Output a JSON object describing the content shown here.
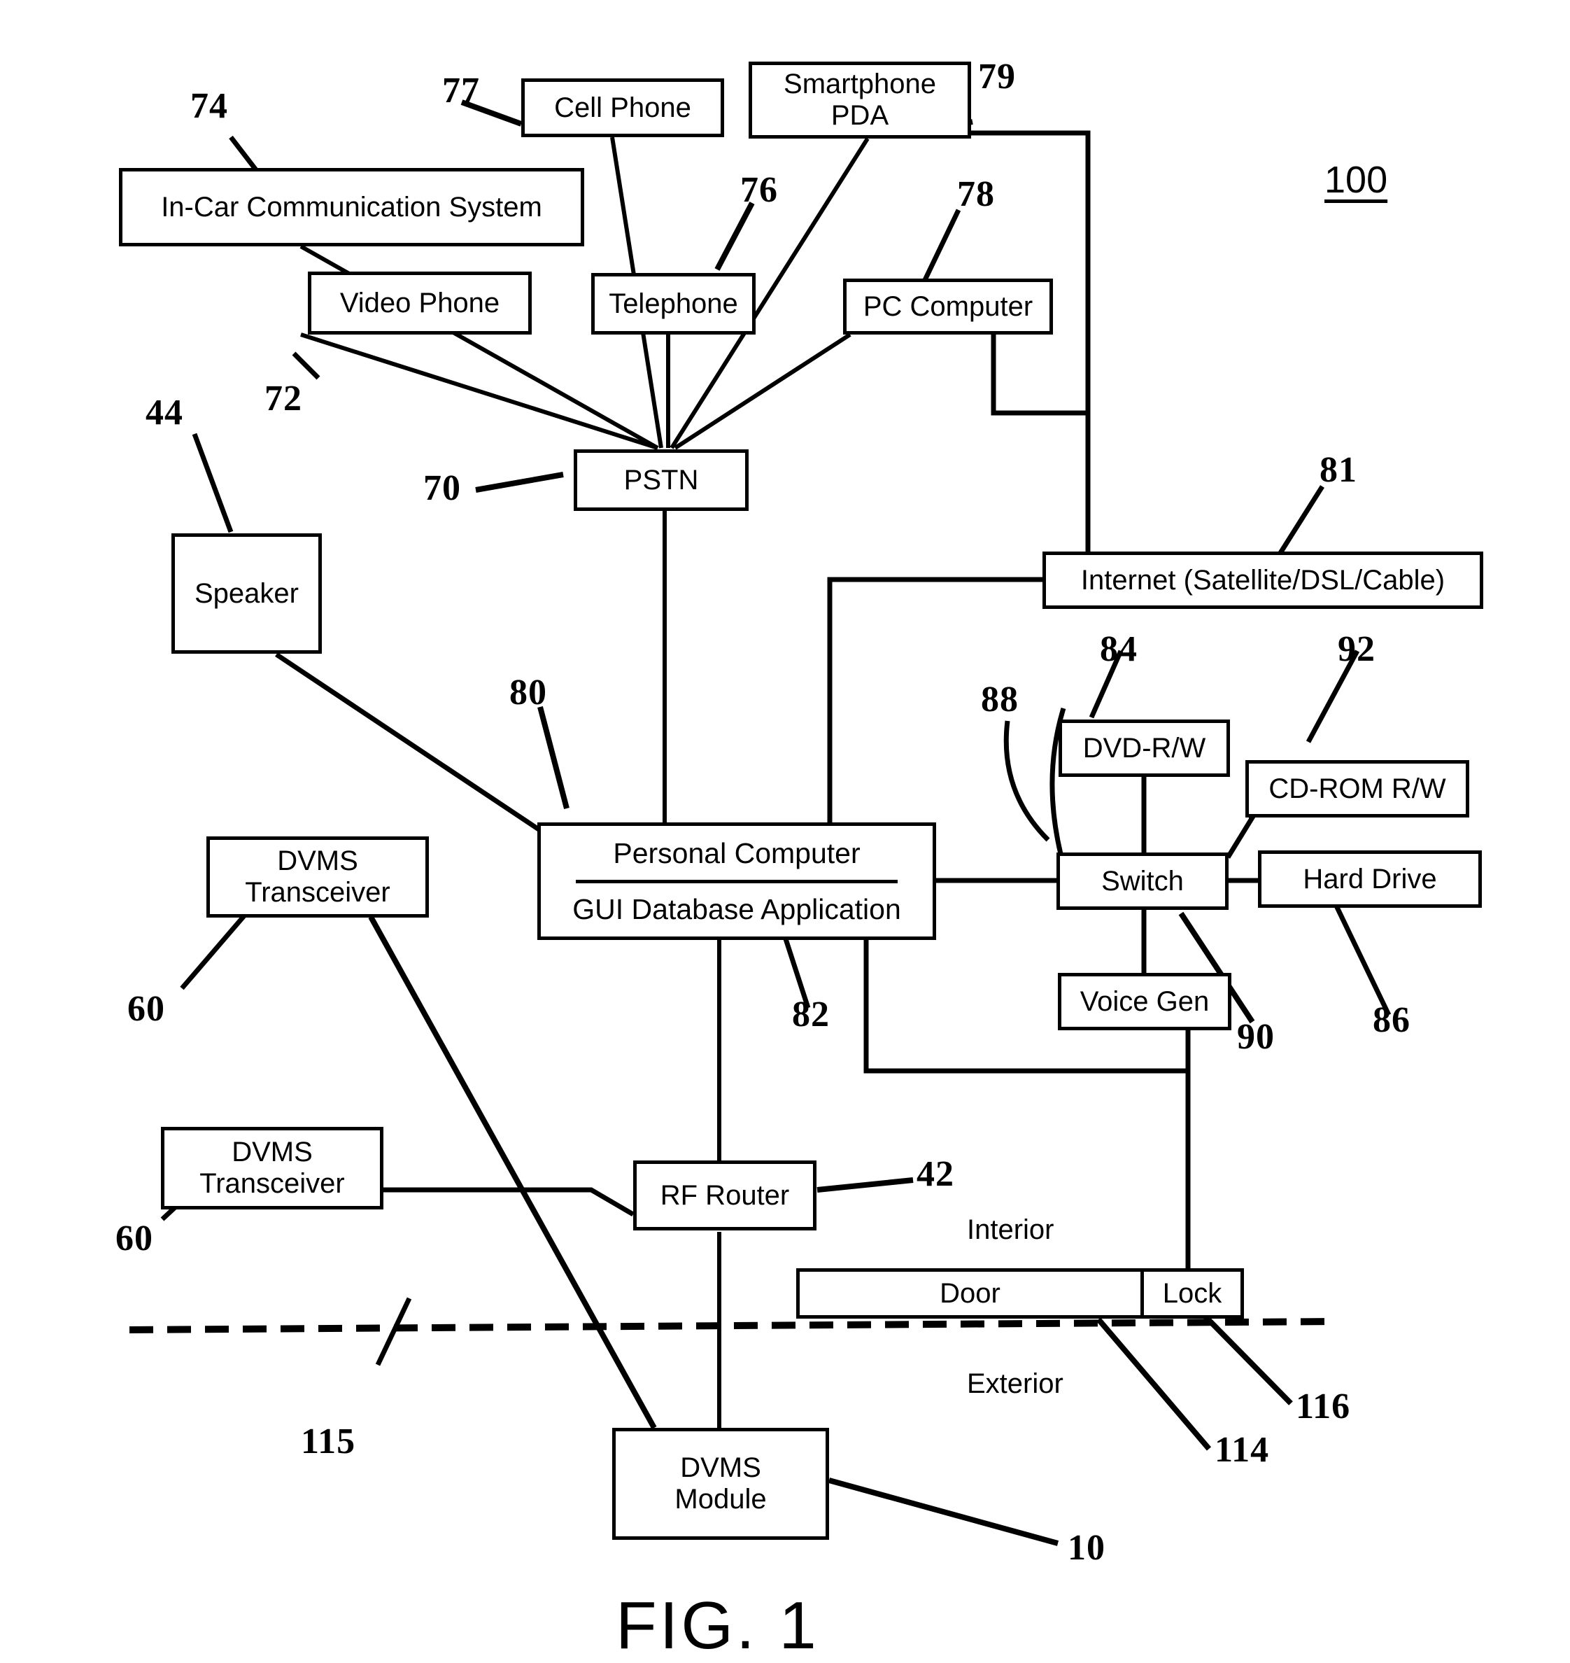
{
  "figure": {
    "caption": "FIG. 1",
    "system_tag": "100"
  },
  "nodes": {
    "in_car": "In-Car Communication System",
    "cell_phone": "Cell Phone",
    "smartphone_pda": "Smartphone\nPDA",
    "smartphone_pda_l1": "Smartphone",
    "smartphone_pda_l2": "PDA",
    "video_phone": "Video Phone",
    "telephone": "Telephone",
    "pc_computer": "PC Computer",
    "pstn": "PSTN",
    "internet": "Internet (Satellite/DSL/Cable)",
    "speaker": "Speaker",
    "personal_computer": "Personal Computer",
    "gui_database_application": "GUI Database Application",
    "dvd_rw": "DVD-R/W",
    "cdrom_rw": "CD-ROM R/W",
    "switch": "Switch",
    "hard_drive": "Hard Drive",
    "voice_gen": "Voice Gen",
    "dvms_transceiver_1_l1": "DVMS",
    "dvms_transceiver_1_l2": "Transceiver",
    "dvms_transceiver_2_l1": "DVMS",
    "dvms_transceiver_2_l2": "Transceiver",
    "rf_router": "RF Router",
    "dvms_module_l1": "DVMS",
    "dvms_module_l2": "Module",
    "door": "Door",
    "lock": "Lock"
  },
  "labels": {
    "interior": "Interior",
    "exterior": "Exterior"
  },
  "refs": {
    "r74": "74",
    "r77": "77",
    "r79": "79",
    "r76": "76",
    "r78": "78",
    "r72": "72",
    "r44": "44",
    "r70": "70",
    "r81": "81",
    "r84": "84",
    "r92": "92",
    "r88": "88",
    "r80": "80",
    "r60a": "60",
    "r60b": "60",
    "r82": "82",
    "r86": "86",
    "r90": "90",
    "r42": "42",
    "r115": "115",
    "r114": "114",
    "r116": "116",
    "r10": "10"
  },
  "colors": {
    "ink": "#000000",
    "paper": "#ffffff"
  }
}
